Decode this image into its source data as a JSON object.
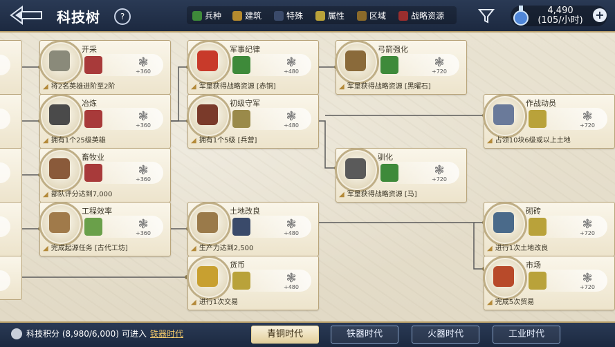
{
  "header": {
    "title": "科技树",
    "help": "?",
    "legend": [
      {
        "label": "兵种",
        "color": "#3e8a3a"
      },
      {
        "label": "建筑",
        "color": "#b58a2e"
      },
      {
        "label": "特殊",
        "color": "#3a4a6a"
      },
      {
        "label": "属性",
        "color": "#b9a23a"
      },
      {
        "label": "区域",
        "color": "#8a6a2a"
      },
      {
        "label": "战略资源",
        "color": "#9a2e2e"
      }
    ],
    "currency": {
      "value": "4,490",
      "rate": "(105/小时)"
    }
  },
  "nodes": [
    {
      "name": "开采",
      "points": "+360",
      "condition": "将2名英雄进阶至2阶",
      "art_color": "#8a8a7a",
      "res_color": "#a83a3a"
    },
    {
      "name": "冶炼",
      "points": "+360",
      "condition": "拥有1个25级英雄",
      "art_color": "#4a4a4a",
      "res_color": "#a83a3a"
    },
    {
      "name": "畜牧业",
      "points": "+360",
      "condition": "部队评分达到7,000",
      "art_color": "#8a5a3a",
      "res_color": "#a83a3a"
    },
    {
      "name": "工程效率",
      "points": "+360",
      "condition": "完成起源任务 [古代工坊]",
      "art_color": "#a07a4a",
      "res_color": "#6aa04a"
    },
    {
      "name": "军事纪律",
      "points": "+480",
      "condition": "军垦获得战略资源 [赤铜]",
      "art_color": "#c83a2a",
      "res_color": "#3e8a3a"
    },
    {
      "name": "初级守军",
      "points": "+480",
      "condition": "拥有1个5级 [兵营]",
      "art_color": "#7a3a2a",
      "res_color": "#9a8a4a"
    },
    {
      "name": "土地改良",
      "points": "+480",
      "condition": "生产力达到2,500",
      "art_color": "#9a7a4a",
      "res_color": "#3a4a6a"
    },
    {
      "name": "货币",
      "points": "+480",
      "condition": "进行1次交易",
      "art_color": "#c8a030",
      "res_color": "#b9a23a"
    },
    {
      "name": "弓箭强化",
      "points": "+720",
      "condition": "军垦获得战略资源 [黑曜石]",
      "art_color": "#8a6a3a",
      "res_color": "#3e8a3a"
    },
    {
      "name": "驯化",
      "points": "+720",
      "condition": "军垦获得战略资源 [马]",
      "art_color": "#5a5a5a",
      "res_color": "#3e8a3a"
    },
    {
      "name": "作战动员",
      "points": "+720",
      "condition": "占领10块6级或以上土地",
      "art_color": "#6a7a9a",
      "res_color": "#b9a23a"
    },
    {
      "name": "砌砖",
      "points": "+720",
      "condition": "进行1次土地改良",
      "art_color": "#4a6a8a",
      "res_color": "#b9a23a"
    },
    {
      "name": "市场",
      "points": "+720",
      "condition": "完成5次贸易",
      "art_color": "#b84a2a",
      "res_color": "#b9a23a"
    }
  ],
  "footer": {
    "score": "科技积分 (8,980/6,000)",
    "enter": "可进入",
    "enter_era": "铁器时代",
    "eras": [
      "青铜时代",
      "铁器时代",
      "火器时代",
      "工业时代"
    ]
  }
}
